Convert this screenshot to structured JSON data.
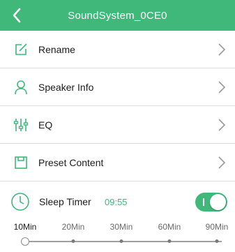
{
  "header": {
    "title": "SoundSystem_0CE0",
    "back_icon": "chevron-left-icon",
    "color": "#3fb87a"
  },
  "menu": {
    "items": [
      {
        "label": "Rename",
        "icon": "edit-icon"
      },
      {
        "label": "Speaker Info",
        "icon": "user-icon"
      },
      {
        "label": "EQ",
        "icon": "equalizer-sliders-icon"
      },
      {
        "label": "Preset Content",
        "icon": "preset-icon"
      }
    ]
  },
  "sleep_timer": {
    "label": "Sleep Timer",
    "time": "09:55",
    "enabled": true,
    "icon": "clock-icon"
  },
  "slider": {
    "options": [
      "10Min",
      "20Min",
      "30Min",
      "60Min",
      "90Min"
    ],
    "selected_index": 0
  }
}
